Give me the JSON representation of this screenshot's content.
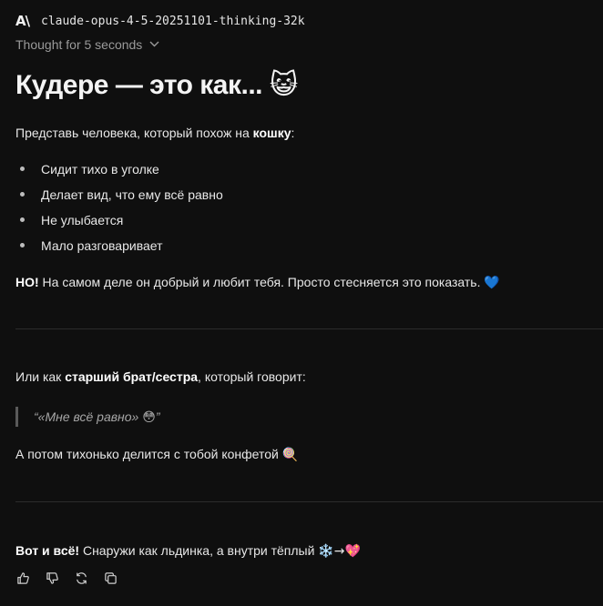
{
  "header": {
    "logo_text": "A\\",
    "model_name": "claude-opus-4-5-20251101-thinking-32k"
  },
  "thinking": {
    "label": "Thought for 5 seconds"
  },
  "message": {
    "heading": "Кудере — это как...",
    "heading_emoji": "😺",
    "intro_prefix": "Представь человека, который похож на ",
    "intro_bold": "кошку",
    "intro_suffix": ":",
    "bullets": [
      "Сидит тихо в уголке",
      "Делает вид, что ему всё равно",
      "Не улыбается",
      "Мало разговаривает"
    ],
    "but_bold": "НО!",
    "but_text": " На самом деле он добрый и любит тебя. Просто стесняется это показать. ",
    "but_emoji": "💙",
    "sibling_prefix": "Или как ",
    "sibling_bold": "старший брат/сестра",
    "sibling_suffix": ", который говорит:",
    "quote_open": "“«Мне всё равно» ",
    "quote_emoji": "😳",
    "quote_close": "”",
    "candy_text": "А потом тихонько делится с тобой конфетой ",
    "candy_emoji": "🍭",
    "final_bold": "Вот и всё!",
    "final_text": " Снаружи как льдинка, а внутри тёплый ",
    "final_emoji": "❄️→💖"
  },
  "actions": {
    "icons": [
      "thumbs-up-icon",
      "thumbs-down-icon",
      "retry-icon",
      "copy-icon"
    ]
  },
  "colors": {
    "background": "#0f0f0f",
    "text": "#e8e8e8",
    "muted": "#9a9a9a",
    "divider": "#2c2c2c"
  }
}
